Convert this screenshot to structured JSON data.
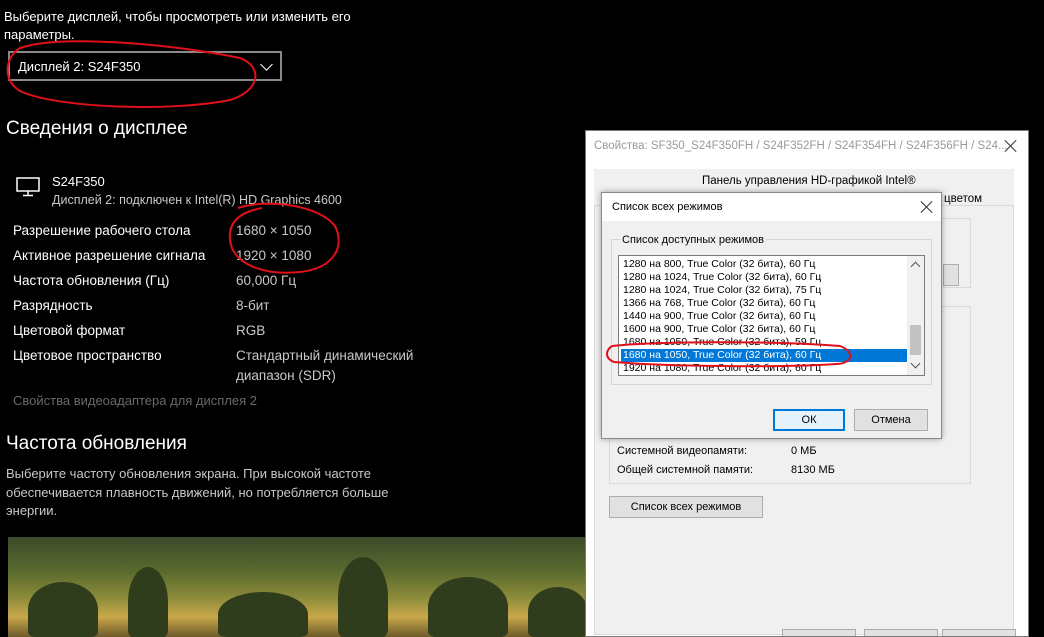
{
  "settings": {
    "choose_display_text": "Выберите дисплей, чтобы просмотреть или изменить его параметры.",
    "choose_display_line1": "Выберите дисплей, чтобы просмотреть или изменить его",
    "choose_display_line2": "параметры.",
    "display_select_value": "Дисплей 2: S24F350",
    "info_heading": "Сведения о дисплее",
    "monitor_name": "S24F350",
    "monitor_connection": "Дисплей 2: подключен к Intel(R) HD Graphics 4600",
    "rows": [
      {
        "label": "Разрешение рабочего стола",
        "value": "1680 × 1050"
      },
      {
        "label": "Активное разрешение сигнала",
        "value": "1920 × 1080"
      },
      {
        "label": "Частота обновления (Гц)",
        "value": "60,000 Гц"
      },
      {
        "label": "Разрядность",
        "value": "8-бит"
      },
      {
        "label": "Цветовой формат",
        "value": "RGB"
      },
      {
        "label": "Цветовое пространство",
        "value": "Стандартный динамический",
        "value2": "диапазон (SDR)"
      }
    ],
    "adapter_link": "Свойства видеоадаптера для дисплея 2",
    "refresh_heading": "Частота обновления",
    "refresh_desc_line1": "Выберите частоту обновления экрана. При высокой частоте",
    "refresh_desc_line2": "обеспечивается плавность движений, но потребляется больше",
    "refresh_desc_line3": "энергии."
  },
  "props_window": {
    "title": "Свойства: SF350_S24F350FH / S24F352FH / S24F354FH / S24F356FH / S24...",
    "tab_top": "Панель управления HD-графикой Intel®",
    "tab_right_fragment": "цветом",
    "system_video_memory_label": "Системной видеопамяти:",
    "system_video_memory_value": "0 МБ",
    "total_system_memory_label": "Общей системной памяти:",
    "total_system_memory_value": "8130 МБ",
    "all_modes_button": "Список всех режимов"
  },
  "modes_dialog": {
    "title": "Список всех режимов",
    "group_label": "Список доступных режимов",
    "modes": [
      "1280 на 800, True Color (32 бита), 60 Гц",
      "1280 на 1024, True Color (32 бита), 60 Гц",
      "1280 на 1024, True Color (32 бита), 75 Гц",
      "1366 на 768, True Color (32 бита), 60 Гц",
      "1440 на 900, True Color (32 бита), 60 Гц",
      "1600 на 900, True Color (32 бита), 60 Гц",
      "1680 на 1050, True Color (32 бита), 59 Гц",
      "1680 на 1050, True Color (32 бита), 60 Гц",
      "1920 на 1080, True Color (32 бита), 60 Гц"
    ],
    "selected_index": 7,
    "ok_label": "ОК",
    "cancel_label": "Отмена"
  },
  "colors": {
    "selection": "#0078d7",
    "annotation_red": "#e0101a"
  }
}
